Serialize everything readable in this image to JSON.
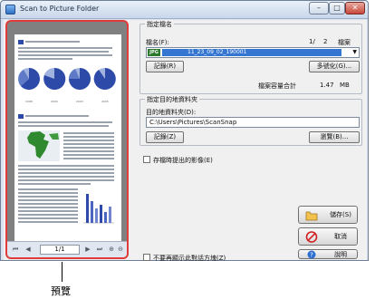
{
  "window": {
    "title": "Scan to Picture Folder",
    "controls": {
      "minimize": "–",
      "maximize": "□",
      "close": "✕"
    }
  },
  "preview": {
    "page_display": "1/1",
    "callout_label": "預覽"
  },
  "file_name_group": {
    "title": "指定檔名",
    "file_name_label": "檔名(F):",
    "page_counter": "1/",
    "page_total": "2",
    "files_label": "檔案",
    "file_type_badge": "JPG",
    "file_name_value": "11_23_09_02_190001",
    "record_button": "記錄(R)",
    "advanced_button": "多號化(G)...",
    "total_size_label": "檔案容量合計",
    "total_size_value": "1.47",
    "total_size_unit": "MB"
  },
  "dest_group": {
    "title": "指定目的地資料夾",
    "folder_label": "目的地資料夾(D):",
    "folder_path": "C:\\Users\\Pictures\\ScanSnap",
    "record_button": "記錄(Z)",
    "browse_button": "瀏覽(B)..."
  },
  "options": {
    "save_exported_label": "存檔時提出的影像(E)",
    "dont_show_again_label": "不要再顯示此對話方塊(Z)"
  },
  "actions": {
    "save_label": "儲存(S)",
    "cancel_label": "取消",
    "help_label": "說明"
  },
  "document_thumbnail": {
    "pie_labels": [
      "1998",
      "2000",
      "2003",
      "2005"
    ]
  },
  "colors": {
    "callout_red": "#e23b3b",
    "selection_blue": "#3476d2",
    "pie_blue": "#2d4aa8"
  }
}
